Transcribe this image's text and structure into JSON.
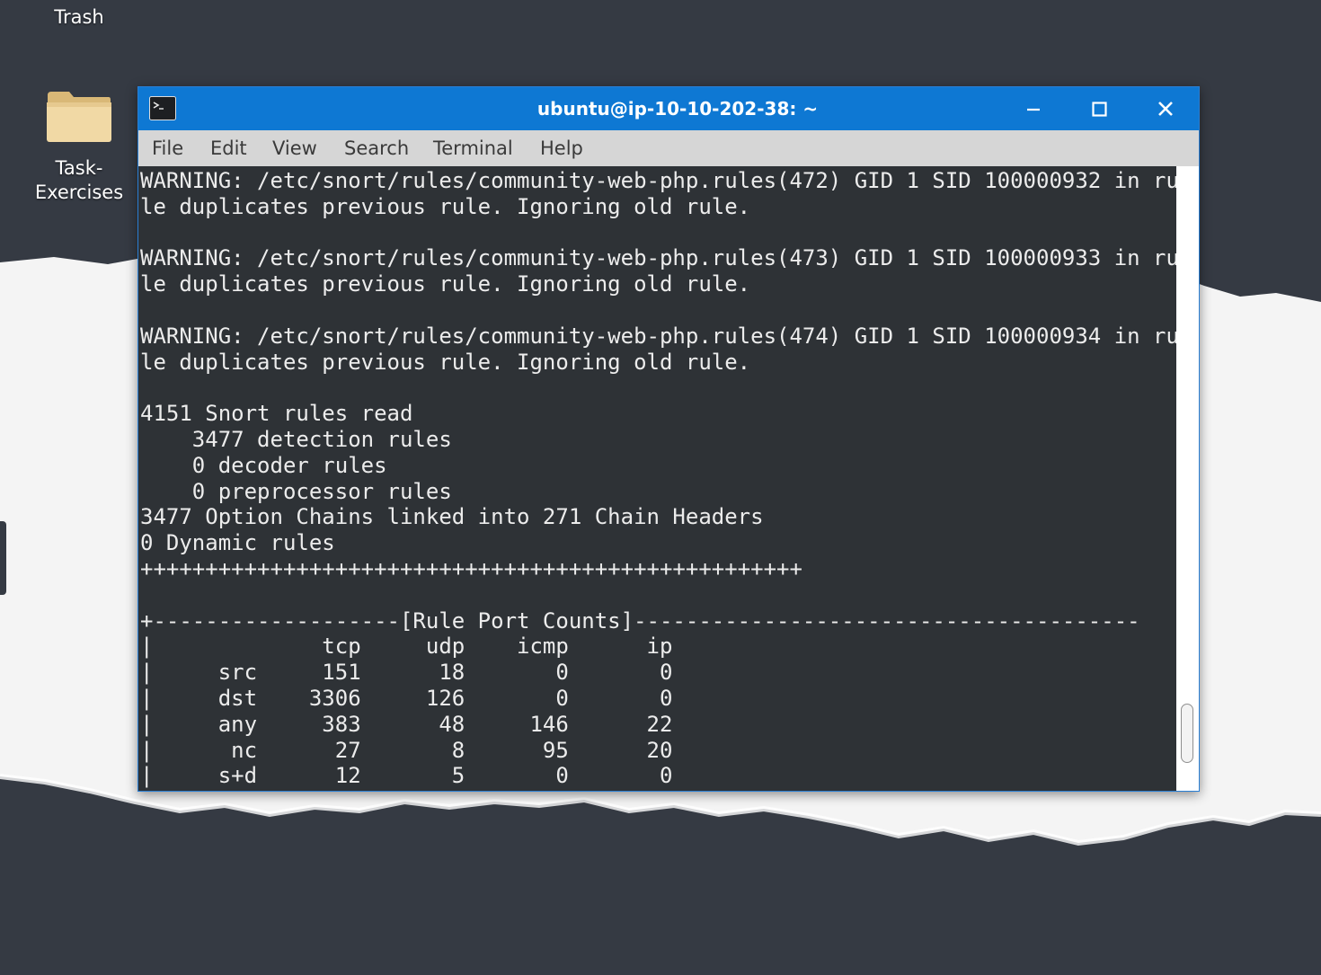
{
  "desktop": {
    "icons": [
      {
        "label": "Trash",
        "icon": "trash-icon"
      },
      {
        "label": "Task-\nExercises",
        "icon": "folder-icon"
      }
    ]
  },
  "window": {
    "title": "ubuntu@ip-10-10-202-38: ~",
    "app_icon": "terminal-icon",
    "controls": {
      "minimize": "minimize-icon",
      "maximize": "maximize-icon",
      "close": "close-icon"
    },
    "accent_color": "#0e78d3"
  },
  "menu": {
    "items": [
      "File",
      "Edit",
      "View",
      "Search",
      "Terminal",
      "Help"
    ]
  },
  "terminal": {
    "background": "#2e3236",
    "foreground": "#ececec",
    "lines": [
      "WARNING: /etc/snort/rules/community-web-php.rules(472) GID 1 SID 100000932 in ru",
      "le duplicates previous rule. Ignoring old rule.",
      "",
      "WARNING: /etc/snort/rules/community-web-php.rules(473) GID 1 SID 100000933 in ru",
      "le duplicates previous rule. Ignoring old rule.",
      "",
      "WARNING: /etc/snort/rules/community-web-php.rules(474) GID 1 SID 100000934 in ru",
      "le duplicates previous rule. Ignoring old rule.",
      "",
      "4151 Snort rules read",
      "    3477 detection rules",
      "    0 decoder rules",
      "    0 preprocessor rules",
      "3477 Option Chains linked into 271 Chain Headers",
      "0 Dynamic rules",
      "+++++++++++++++++++++++++++++++++++++++++++++++++++",
      "",
      "+-------------------[Rule Port Counts]---------------------------------------",
      "|             tcp     udp    icmp      ip",
      "|     src     151      18       0       0",
      "|     dst    3306     126       0       0",
      "|     any     383      48     146      22",
      "|      nc      27       8      95      20",
      "|     s+d      12       5       0       0"
    ]
  }
}
